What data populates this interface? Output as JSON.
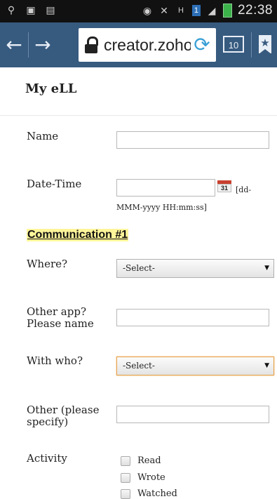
{
  "status_bar": {
    "time": "22:38",
    "left_icons": [
      "usb-icon",
      "image-icon",
      "shopping-bag-icon"
    ],
    "right_icons": [
      "eye-icon",
      "mute-icon",
      "network-h-icon",
      "sim-icon",
      "signal-icon",
      "battery-icon"
    ],
    "sim_label": "1",
    "network_label": "H"
  },
  "browser": {
    "back_icon": "←",
    "forward_icon": "→",
    "url": "creator.zohop",
    "reload_icon": "⟳",
    "tab_count": "10",
    "bookmark_icon": "★"
  },
  "page": {
    "title": "My eLL"
  },
  "form": {
    "name_label": "Name",
    "name_value": "",
    "datetime_label": "Date-Time",
    "datetime_value": "",
    "calendar_day": "31",
    "datetime_hint_1": "[dd-",
    "datetime_hint_2": "MMM-yyyy HH:mm:ss]",
    "section_title": "Communication #1",
    "where_label": "Where?",
    "where_value": "-Select-",
    "other_app_label_1": "Other app?",
    "other_app_label_2": "Please name",
    "other_app_value": "",
    "with_who_label": "With who?",
    "with_who_value": "-Select-",
    "other_specify_label_1": "Other (please",
    "other_specify_label_2": "specify)",
    "other_specify_value": "",
    "activity_label": "Activity",
    "activities": [
      "Read",
      "Wrote",
      "Watched"
    ]
  }
}
